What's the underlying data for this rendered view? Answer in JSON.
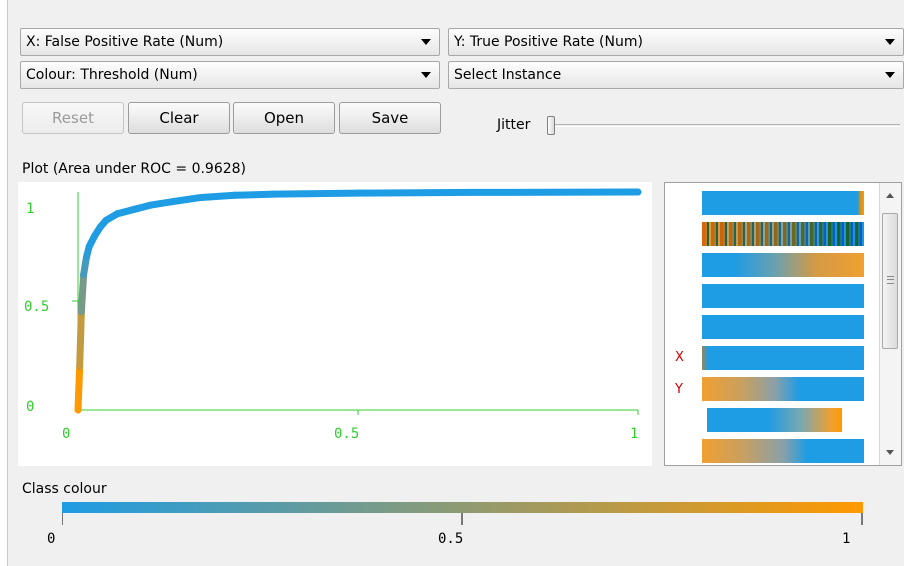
{
  "axis_selectors": {
    "x": "X: False Positive Rate (Num)",
    "y": "Y: True Positive Rate (Num)",
    "colour": "Colour: Threshold (Num)",
    "instance": "Select Instance"
  },
  "buttons": {
    "reset": "Reset",
    "clear": "Clear",
    "open": "Open",
    "save": "Save"
  },
  "jitter": {
    "label": "Jitter",
    "value": 0
  },
  "plot": {
    "title": "Plot (Area under ROC = 0.9628)",
    "y_ticks": [
      "1",
      "0.5",
      "0"
    ],
    "x_ticks": [
      "0",
      "0.5",
      "1"
    ]
  },
  "side_panel": {
    "x_marker": "X",
    "y_marker": "Y"
  },
  "class_colour": {
    "title": "Class colour",
    "ticks": [
      "0",
      "0.5",
      "1"
    ]
  },
  "colors": {
    "low": "#1e9ce4",
    "high": "#ff9900",
    "axis": "#33cc33"
  },
  "chart_data": {
    "type": "line",
    "title": "Plot (Area under ROC = 0.9628)",
    "xlabel": "False Positive Rate",
    "ylabel": "True Positive Rate",
    "xlim": [
      0,
      1
    ],
    "ylim": [
      0,
      1
    ],
    "x_ticks": [
      "0",
      "0.5",
      "1"
    ],
    "y_ticks": [
      "0",
      "0.5",
      "1"
    ],
    "series": [
      {
        "x": [
          0,
          0.003,
          0.006,
          0.01,
          0.015,
          0.02,
          0.03,
          0.04,
          0.05,
          0.07,
          0.1,
          0.13,
          0.18,
          0.22,
          0.28,
          0.35,
          0.5,
          0.7,
          1
        ],
        "y": [
          0,
          0.2,
          0.45,
          0.62,
          0.7,
          0.75,
          0.8,
          0.84,
          0.87,
          0.9,
          0.92,
          0.94,
          0.96,
          0.975,
          0.985,
          0.99,
          0.995,
          0.998,
          1
        ]
      }
    ]
  }
}
